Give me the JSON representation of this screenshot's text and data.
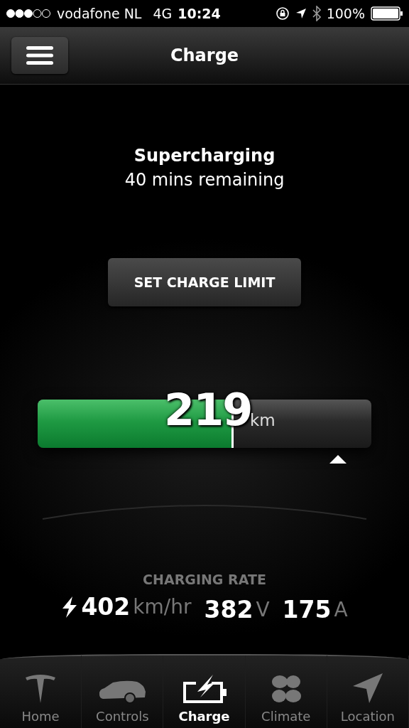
{
  "status_bar": {
    "carrier": "vodafone NL",
    "network": "4G",
    "time": "10:24",
    "battery": "100%"
  },
  "nav_bar": {
    "title": "Charge"
  },
  "charge_status": {
    "title": "Supercharging",
    "subtitle": "40 mins remaining"
  },
  "set_limit_button": {
    "label": "SET CHARGE LIMIT"
  },
  "range_bar": {
    "value": "219",
    "unit": "km",
    "level": 0.58
  },
  "charging_rate": {
    "heading": "CHARGING RATE",
    "readings": [
      {
        "kind": "bolt",
        "value": "402",
        "unit": "km/hr"
      },
      {
        "kind": "plain",
        "value": "382",
        "unit": "V"
      },
      {
        "kind": "plain",
        "value": "175",
        "unit": "A"
      }
    ]
  },
  "tabs": [
    {
      "kind": "logo",
      "label": "Home",
      "selected": false
    },
    {
      "kind": "car",
      "label": "Controls",
      "selected": false
    },
    {
      "kind": "charge",
      "label": "Charge",
      "selected": true
    },
    {
      "kind": "fan",
      "label": "Climate",
      "selected": false
    },
    {
      "kind": "location",
      "label": "Location",
      "selected": false
    }
  ]
}
